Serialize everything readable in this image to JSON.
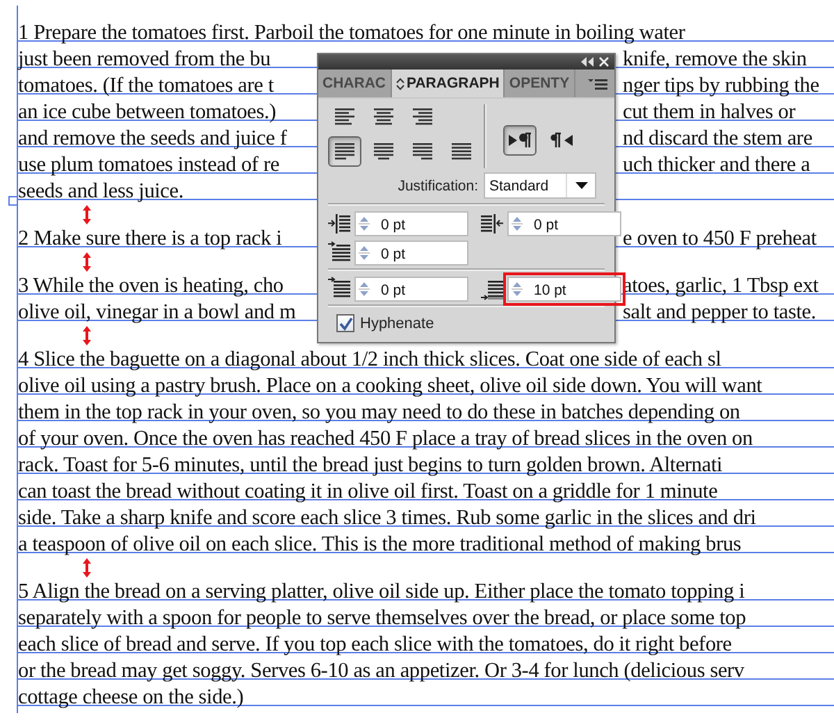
{
  "document": {
    "paragraphs": [
      {
        "lines": [
          {
            "text": "1 Prepare the tomatoes first. Parboil the tomatoes for one minute in boiling water"
          },
          {
            "left": "just been removed from the bu",
            "right": "knife, remove the skin"
          },
          {
            "left": "tomatoes. (If the tomatoes are t",
            "right": "nger tips by rubbing the"
          },
          {
            "left": "an ice cube between tomatoes.)",
            "right": "cut them in halves or"
          },
          {
            "left": "and remove the seeds and juice f",
            "right": "nd discard the stem are"
          },
          {
            "left": "use plum tomatoes instead of re",
            "right": "uch thicker and there a"
          },
          {
            "text": "seeds and less juice."
          }
        ]
      },
      {
        "lines": [
          {
            "left": "2 Make sure there is a top rack i",
            "right": "e oven to 450 F preheat"
          }
        ]
      },
      {
        "lines": [
          {
            "left": "3 While the oven is heating, cho",
            "right": "atoes, garlic, 1 Tbsp ext"
          },
          {
            "left": "olive oil, vinegar in a bowl and m",
            "right": "salt and pepper to taste."
          }
        ]
      },
      {
        "lines": [
          {
            "text": "4 Slice the baguette on a diagonal about 1/2 inch thick slices. Coat one side of each sl"
          },
          {
            "text": "olive oil using a pastry brush. Place on a cooking sheet, olive oil side down. You will want"
          },
          {
            "text": "them in the top rack in your oven, so you may need to do these in batches depending on"
          },
          {
            "text": "of your oven. Once the oven has reached 450 F place a tray of bread slices in the oven on"
          },
          {
            "text": "rack. Toast for 5-6 minutes, until the bread just begins to turn golden brown. Alternati"
          },
          {
            "text": "can toast the bread without coating it in olive oil first. Toast on a griddle for 1 minute"
          },
          {
            "text": "side. Take a sharp knife and score each slice 3 times. Rub some garlic in the slices and dri"
          },
          {
            "text": "a teaspoon of olive oil on each slice. This is the more traditional method of making brus"
          }
        ]
      },
      {
        "lines": [
          {
            "text": "5 Align the bread on a serving platter, olive oil side up. Either place the tomato topping i"
          },
          {
            "text": "separately with a spoon for people to serve themselves over the bread, or place some top"
          },
          {
            "text": "each slice of bread and serve. If you top each slice with the tomatoes, do it right before"
          },
          {
            "text": "or the bread may get soggy. Serves 6-10 as an appetizer. Or 3-4 for lunch (delicious serv"
          },
          {
            "text": "cottage cheese on the side.)"
          }
        ]
      }
    ]
  },
  "panel": {
    "tabs": [
      {
        "label": "CHARAC",
        "selected": false
      },
      {
        "label": "PARAGRAPH",
        "selected": true
      },
      {
        "label": "OPENTY",
        "selected": false
      }
    ],
    "alignment": [
      {
        "kind": "left",
        "selected": false
      },
      {
        "kind": "center",
        "selected": false
      },
      {
        "kind": "right",
        "selected": false
      },
      {
        "kind": "justify-left",
        "selected": true
      },
      {
        "kind": "justify-center",
        "selected": false
      },
      {
        "kind": "justify-right",
        "selected": false
      },
      {
        "kind": "justify-all",
        "selected": false
      }
    ],
    "direction": [
      {
        "kind": "ltr",
        "selected": true
      },
      {
        "kind": "rtl",
        "selected": false
      }
    ],
    "justification": {
      "label": "Justification:",
      "value": "Standard"
    },
    "indent_rows": [
      [
        {
          "kind": "left-indent",
          "value": "0 pt",
          "highlighted": false
        },
        {
          "kind": "right-indent",
          "value": "0 pt",
          "highlighted": false
        }
      ],
      [
        {
          "kind": "first-line-indent",
          "value": "0 pt",
          "highlighted": false
        }
      ]
    ],
    "spacing_rows": [
      [
        {
          "kind": "space-before",
          "value": "0 pt",
          "highlighted": false
        },
        {
          "kind": "space-after",
          "value": "10 pt",
          "highlighted": true
        }
      ]
    ],
    "hyphenate": {
      "label": "Hyphenate",
      "checked": true
    }
  }
}
